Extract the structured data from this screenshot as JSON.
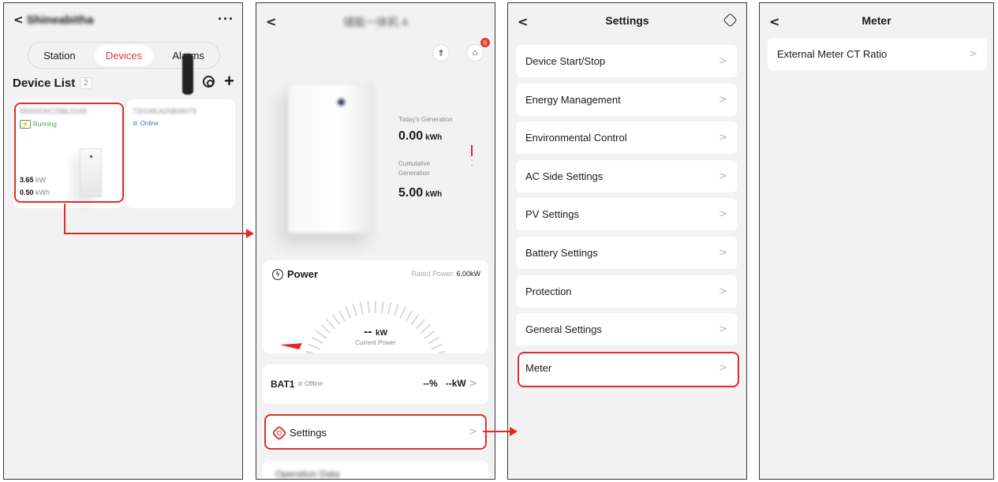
{
  "panel1": {
    "station_name": "Shineabitha",
    "tabs": [
      "Station",
      "Devices",
      "Alarms"
    ],
    "device_list_title": "Device List",
    "device_count": "2",
    "devices": [
      {
        "sn": "55000D6C25BLD165",
        "status": "Running",
        "power": "3.65",
        "power_unit": "kW",
        "energy": "0.50",
        "energy_unit": "kWh"
      },
      {
        "sn": "7201WLA25B06079",
        "status": "Online"
      }
    ]
  },
  "panel2": {
    "device_title": "储能一体机 4",
    "notification_count": "6",
    "todays_generation_label": "Today's Generation",
    "todays_generation_value": "0.00",
    "todays_generation_unit": "kWh",
    "cumulative_generation_label_1": "Cumulative",
    "cumulative_generation_label_2": "Generation",
    "cumulative_generation_value": "5.00",
    "cumulative_generation_unit": "kWh",
    "power_title": "Power",
    "rated_power_label": "Rated Power:",
    "rated_power_value": "6.00kW",
    "current_power_value": "--",
    "current_power_unit": "kW",
    "current_power_label": "Current Power",
    "battery_name": "BAT1",
    "battery_status": "Offline",
    "battery_soc": "--%",
    "battery_power": "--kW",
    "settings_label": "Settings",
    "next_card_label": "Operation Data"
  },
  "panel3": {
    "title": "Settings",
    "items": [
      "Device Start/Stop",
      "Energy Management",
      "Environmental Control",
      "AC Side Settings",
      "PV Settings",
      "Battery Settings",
      "Protection",
      "General Settings",
      "Meter"
    ]
  },
  "panel4": {
    "title": "Meter",
    "items": [
      "External Meter CT Ratio"
    ]
  },
  "colors": {
    "accent": "#e13a3a",
    "highlight": "#e12b2b",
    "running": "#3aa84a",
    "online": "#3a72d8",
    "background": "#f2f2f2"
  }
}
